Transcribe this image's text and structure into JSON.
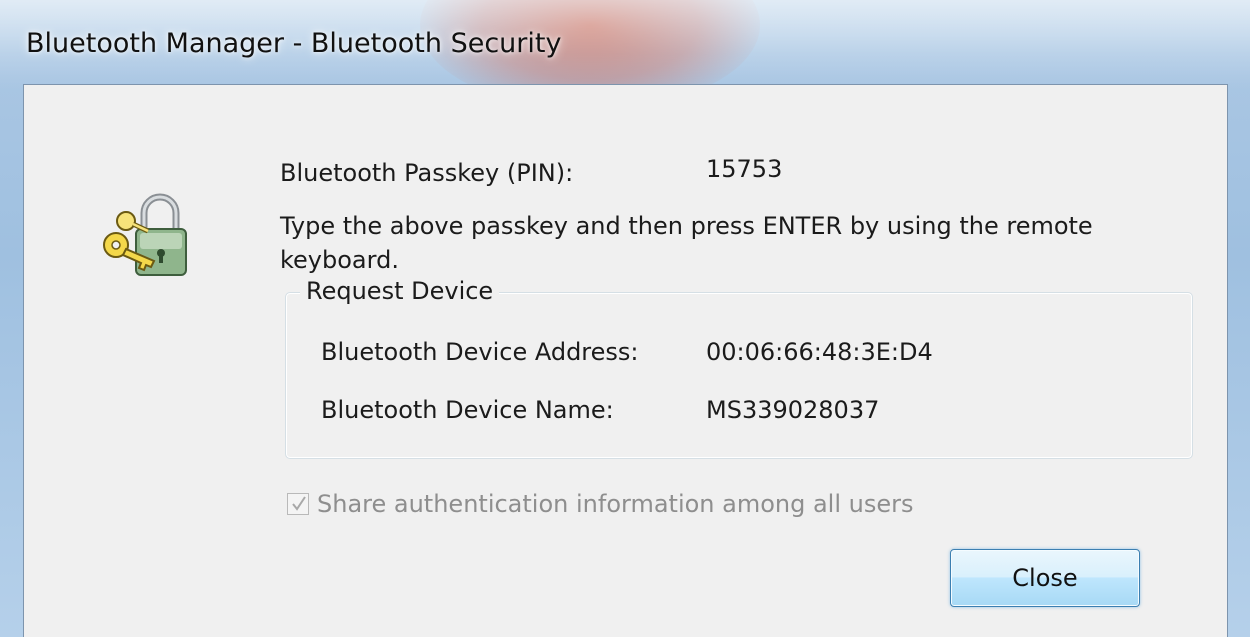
{
  "window": {
    "title": "Bluetooth Manager - Bluetooth Security"
  },
  "icons": {
    "main": "padlock-with-key-icon",
    "checkbox_mark": "checkmark-icon"
  },
  "passkey": {
    "label": "Bluetooth Passkey (PIN):",
    "value": "15753"
  },
  "instruction": "Type the above passkey and then press ENTER by using the remote keyboard.",
  "request_device": {
    "legend": "Request Device",
    "address_label": "Bluetooth Device Address:",
    "address_value": "00:06:66:48:3E:D4",
    "name_label": "Bluetooth Device Name:",
    "name_value": "MS339028037"
  },
  "share_checkbox": {
    "label": "Share authentication information among all users",
    "checked": true,
    "disabled": true
  },
  "buttons": {
    "close_label": "Close"
  },
  "colors": {
    "client_bg": "#f0f0f0",
    "disabled_text": "#8e8e8e",
    "button_border": "#3c7fb1"
  }
}
